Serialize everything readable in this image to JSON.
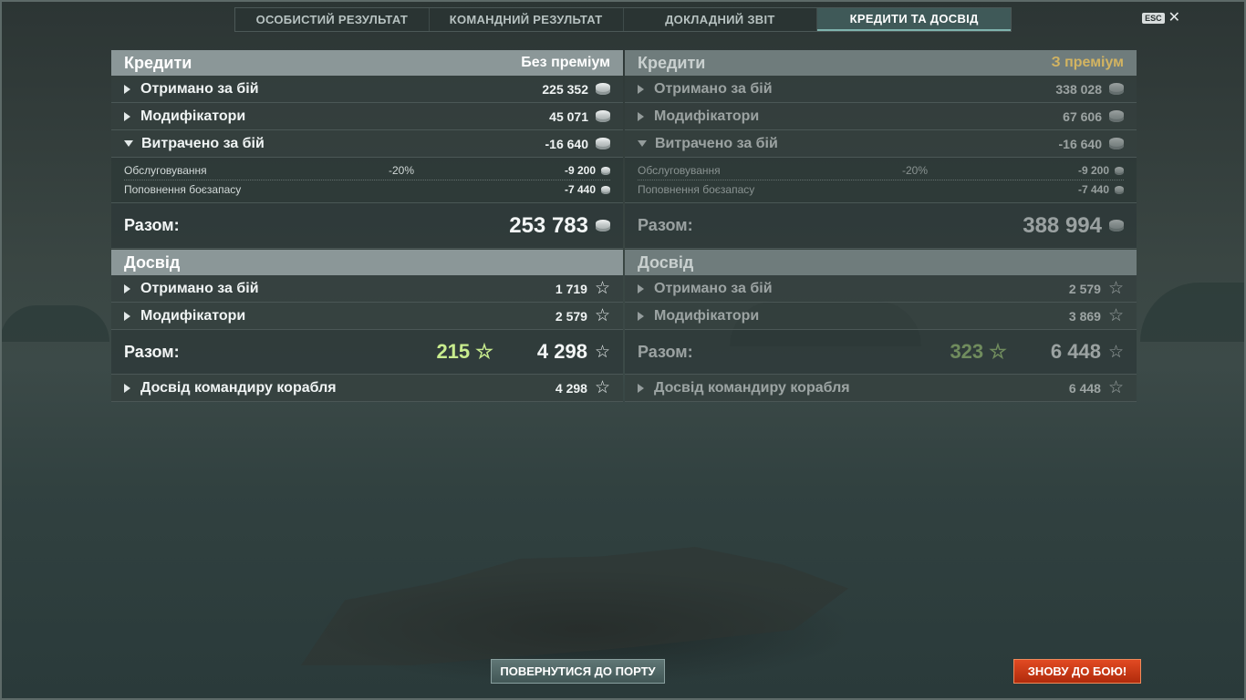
{
  "tabs": [
    {
      "label": "ОСОБИСТИЙ РЕЗУЛЬТАТ"
    },
    {
      "label": "КОМАНДНИЙ РЕЗУЛЬТАТ"
    },
    {
      "label": "ДОКЛАДНИЙ ЗВІТ"
    },
    {
      "label": "КРЕДИТИ ТА ДОСВІД"
    }
  ],
  "active_tab": "КРЕДИТИ ТА ДОСВІД",
  "esc_label": "ESC",
  "close_glyph": "✕",
  "icons": {
    "credits": "credit-coin-icon",
    "xp": "star-icon",
    "expand": "triangle-icon"
  },
  "left": {
    "credits_title": "Кредити",
    "credits_sub": "Без преміум",
    "rows": [
      {
        "label": "Отримано за бій",
        "value": "225 352"
      },
      {
        "label": "Модифікатори",
        "value": "45 071"
      },
      {
        "label": "Витрачено за бій",
        "value": "-16 640"
      }
    ],
    "expenses": [
      {
        "label": "Обслуговування",
        "pct": "-20%",
        "value": "-9 200"
      },
      {
        "label": "Поповнення боєзапасу",
        "pct": "",
        "value": "-7 440"
      }
    ],
    "total_label": "Разом:",
    "total_value": "253 783",
    "xp_title": "Досвід",
    "xp_rows": [
      {
        "label": "Отримано за бій",
        "value": "1 719"
      },
      {
        "label": "Модифікатори",
        "value": "2 579"
      }
    ],
    "xp_total_label": "Разом:",
    "xp_free": "215",
    "xp_total": "4 298",
    "commander_label": "Досвід командиру корабля",
    "commander_value": "4 298"
  },
  "right": {
    "credits_title": "Кредити",
    "credits_sub": "З преміум",
    "rows": [
      {
        "label": "Отримано за бій",
        "value": "338 028"
      },
      {
        "label": "Модифікатори",
        "value": "67 606"
      },
      {
        "label": "Витрачено за бій",
        "value": "-16 640"
      }
    ],
    "expenses": [
      {
        "label": "Обслуговування",
        "pct": "-20%",
        "value": "-9 200"
      },
      {
        "label": "Поповнення боєзапасу",
        "pct": "",
        "value": "-7 440"
      }
    ],
    "total_label": "Разом:",
    "total_value": "388 994",
    "xp_title": "Досвід",
    "xp_rows": [
      {
        "label": "Отримано за бій",
        "value": "2 579"
      },
      {
        "label": "Модифікатори",
        "value": "3 869"
      }
    ],
    "xp_total_label": "Разом:",
    "xp_free": "323",
    "xp_total": "6 448",
    "commander_label": "Досвід командиру корабля",
    "commander_value": "6 448"
  },
  "buttons": {
    "port": "ПОВЕРНУТИСЯ ДО ПОРТУ",
    "battle": "ЗНОВУ ДО БОЮ!"
  },
  "colors": {
    "accent_battle": "#c9361a",
    "premium": "#d3b461",
    "free_xp": "#c8ec8e"
  }
}
